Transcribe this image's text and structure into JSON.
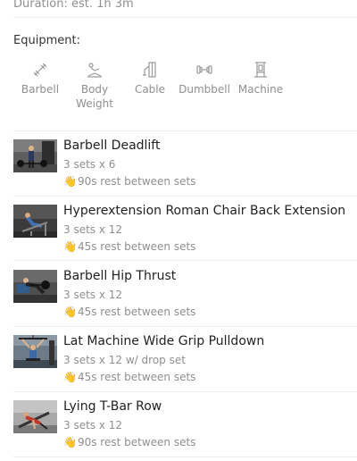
{
  "duration_text": "Duration: est. 1h 3m",
  "equipment": {
    "title": "Equipment:",
    "items": [
      {
        "icon": "barbell-icon",
        "label": "Barbell"
      },
      {
        "icon": "body-weight-icon",
        "label": "Body\nWeight"
      },
      {
        "icon": "cable-icon",
        "label": "Cable"
      },
      {
        "icon": "dumbbell-icon",
        "label": "Dumbbell"
      },
      {
        "icon": "machine-icon",
        "label": "Machine"
      }
    ]
  },
  "hand_emoji": "👋",
  "exercises": [
    {
      "name": "Barbell Deadlift",
      "sets": "3 sets x 6",
      "rest": "90s rest between sets",
      "thumb_bg": "#6b6b6b"
    },
    {
      "name": "Hyperextension Roman Chair Back Extension",
      "sets": "3 sets x 12",
      "rest": "45s rest between sets",
      "thumb_bg": "#3a3a3a"
    },
    {
      "name": "Barbell Hip Thrust",
      "sets": "3 sets x 12",
      "rest": "45s rest between sets",
      "thumb_bg": "#555555"
    },
    {
      "name": "Lat Machine Wide Grip Pulldown",
      "sets": "3 sets x 12 w/ drop set",
      "rest": "45s rest between sets",
      "thumb_bg": "#5d6a78"
    },
    {
      "name": "Lying T-Bar Row",
      "sets": "3 sets x 12",
      "rest": "90s rest between sets",
      "thumb_bg": "#9a9a9a"
    }
  ]
}
